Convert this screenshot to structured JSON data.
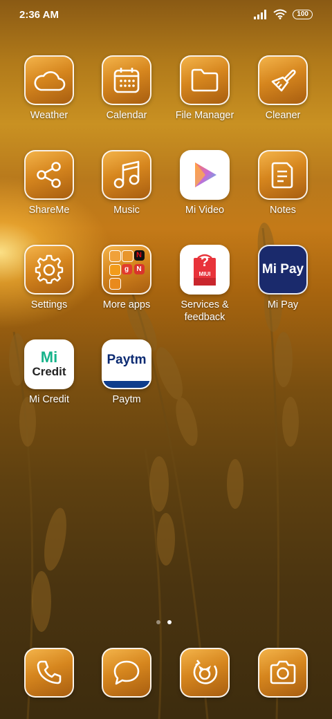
{
  "status_bar": {
    "time": "2:36 AM",
    "battery": "100"
  },
  "apps": {
    "weather": "Weather",
    "calendar": "Calendar",
    "file_manager": "File Manager",
    "cleaner": "Cleaner",
    "shareme": "ShareMe",
    "music": "Music",
    "mi_video": "Mi Video",
    "notes": "Notes",
    "settings": "Settings",
    "more_apps": "More apps",
    "services_line1": "Services &",
    "services_line2": "feedback",
    "mi_pay": "Mi Pay",
    "mi_credit": "Mi Credit",
    "paytm": "Paytm"
  },
  "icon_text": {
    "mi_pay": "Mi Pay",
    "mi_credit_mark": "Mi",
    "mi_credit_word": "Credit",
    "paytm": "Paytm",
    "services_badge": "MIUI",
    "services_q": "?"
  },
  "dock": [
    "phone-icon",
    "messages-icon",
    "themes-icon",
    "camera-icon"
  ],
  "page_indicator": {
    "pages": 2,
    "active": 2
  }
}
